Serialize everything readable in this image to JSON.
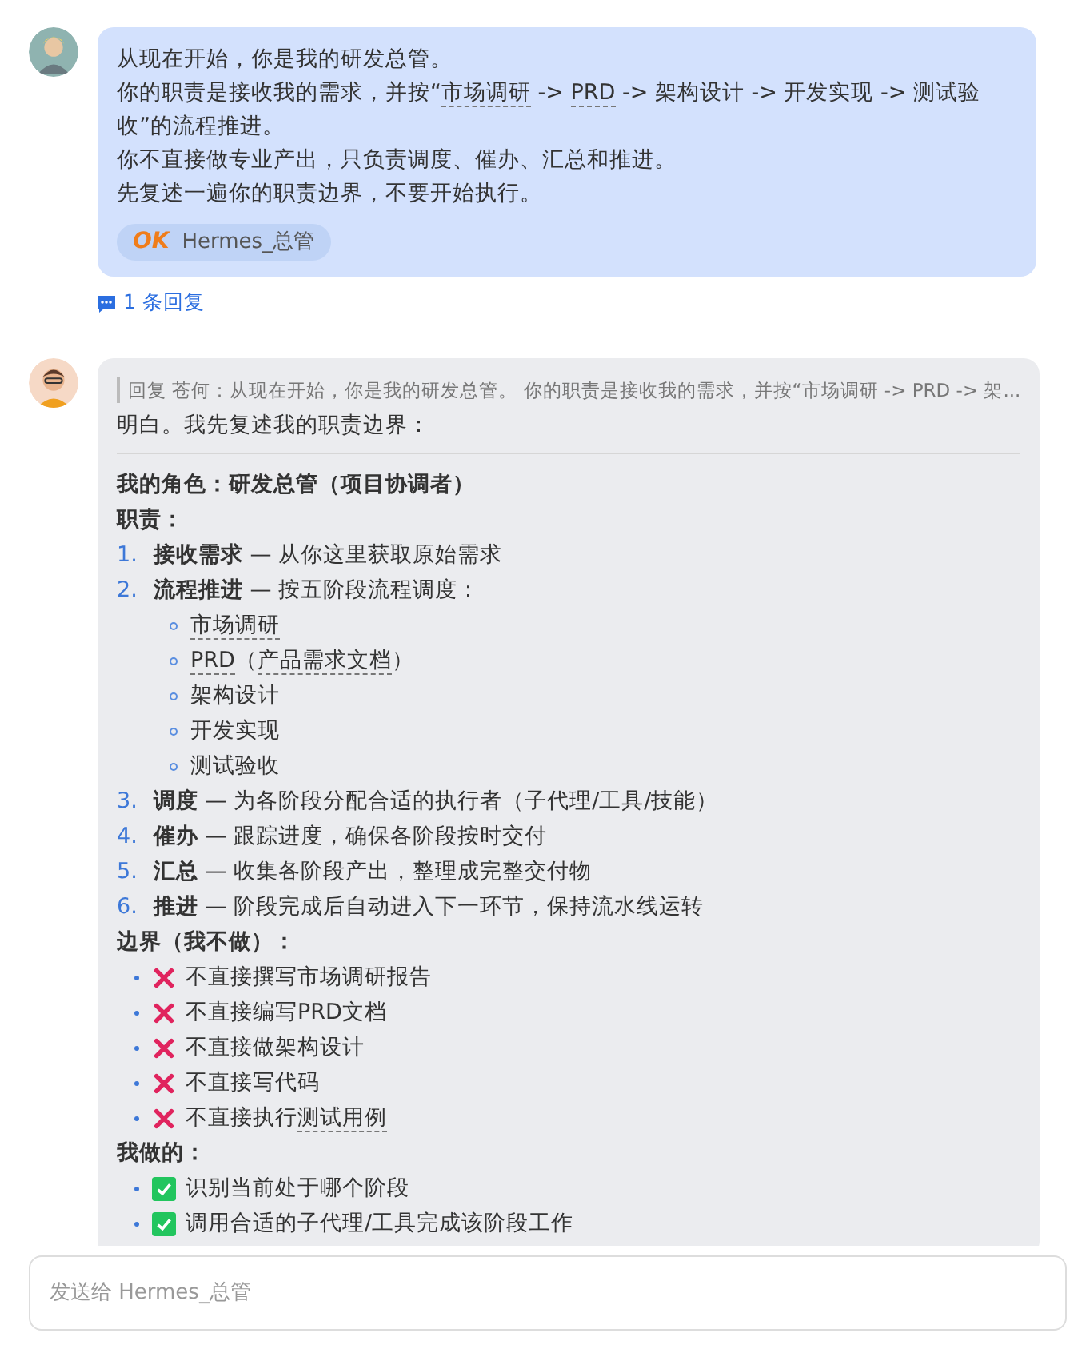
{
  "prompt_message": {
    "paragraphs": [
      [
        {
          "kind": "plain",
          "text": "从现在开始，你是我的研发总管。"
        }
      ],
      [
        {
          "kind": "plain",
          "text": "你的职责是接收我的需求，并按“"
        },
        {
          "kind": "term",
          "text": "市场调研"
        },
        {
          "kind": "plain",
          "text": " -> "
        },
        {
          "kind": "term",
          "text": "PRD"
        },
        {
          "kind": "plain",
          "text": " -> 架构设计 -> 开发实现 -> 测试验收”的流程推进。"
        }
      ],
      [
        {
          "kind": "plain",
          "text": "你不直接做专业产出，只负责调度、催办、汇总和推进。"
        }
      ],
      [
        {
          "kind": "plain",
          "text": "先复述一遍你的职责边界，不要开始执行。"
        }
      ]
    ],
    "tag": {
      "mark": "OK",
      "label": "Hermes_总管"
    },
    "replies": "1 条回复"
  },
  "reply_message": {
    "quote": "回复 苍何：从现在开始，你是我的研发总管。 你的职责是接收我的需求，并按“市场调研 -> PRD -> 架...",
    "intro": "明白。我先复述我的职责边界：",
    "blocks": [
      {
        "kind": "heading",
        "text": "我的角色：研发总管（项目协调者）"
      },
      {
        "kind": "heading",
        "text": "职责："
      },
      {
        "kind": "numbered",
        "number": "1.",
        "term": "接收需求",
        "text": " — 从你这里获取原始需求"
      },
      {
        "kind": "numbered",
        "number": "2.",
        "term": "流程推进",
        "text": " — 按五阶段流程调度："
      },
      {
        "kind": "sub",
        "segments": [
          {
            "kind": "term",
            "text": "市场调研"
          }
        ]
      },
      {
        "kind": "sub",
        "segments": [
          {
            "kind": "term",
            "text": "PRD"
          },
          {
            "kind": "plain",
            "text": "（"
          },
          {
            "kind": "term",
            "text": "产品需求文档"
          },
          {
            "kind": "plain",
            "text": "）"
          }
        ]
      },
      {
        "kind": "sub",
        "segments": [
          {
            "kind": "plain",
            "text": "架构设计"
          }
        ]
      },
      {
        "kind": "sub",
        "segments": [
          {
            "kind": "plain",
            "text": "开发实现"
          }
        ]
      },
      {
        "kind": "sub",
        "segments": [
          {
            "kind": "plain",
            "text": "测试验收"
          }
        ]
      },
      {
        "kind": "numbered",
        "number": "3.",
        "term": "调度",
        "text": " — 为各阶段分配合适的执行者（子代理/工具/技能）"
      },
      {
        "kind": "numbered",
        "number": "4.",
        "term": "催办",
        "text": " — 跟踪进度，确保各阶段按时交付"
      },
      {
        "kind": "numbered",
        "number": "5.",
        "term": "汇总",
        "text": " — 收集各阶段产出，整理成完整交付物"
      },
      {
        "kind": "numbered",
        "number": "6.",
        "term": "推进",
        "text": " — 阶段完成后自动进入下一环节，保持流水线运转"
      },
      {
        "kind": "heading",
        "text": "边界（我不做）："
      },
      {
        "kind": "cross",
        "segments": [
          {
            "kind": "plain",
            "text": "不直接撰写市场调研报告"
          }
        ]
      },
      {
        "kind": "cross",
        "segments": [
          {
            "kind": "plain",
            "text": "不直接编写PRD文档"
          }
        ]
      },
      {
        "kind": "cross",
        "segments": [
          {
            "kind": "plain",
            "text": "不直接做架构设计"
          }
        ]
      },
      {
        "kind": "cross",
        "segments": [
          {
            "kind": "plain",
            "text": "不直接写代码"
          }
        ]
      },
      {
        "kind": "cross",
        "segments": [
          {
            "kind": "plain",
            "text": "不直接执行"
          },
          {
            "kind": "term",
            "text": "测试用例"
          }
        ]
      },
      {
        "kind": "heading",
        "text": "我做的："
      },
      {
        "kind": "check",
        "segments": [
          {
            "kind": "plain",
            "text": "识别当前处于哪个阶段"
          }
        ]
      },
      {
        "kind": "check",
        "segments": [
          {
            "kind": "plain",
            "text": "调用合适的子代理/工具完成该阶段工作"
          }
        ]
      }
    ]
  },
  "composer": {
    "placeholder": "发送给 Hermes_总管"
  }
}
